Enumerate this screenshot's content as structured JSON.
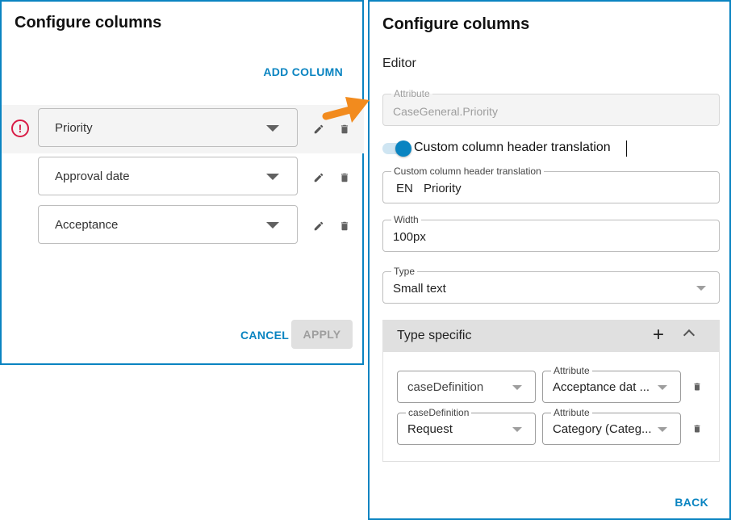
{
  "left_panel": {
    "title": "Configure columns",
    "add_column_label": "ADD COLUMN",
    "columns": [
      {
        "value": "Priority",
        "error": true
      },
      {
        "value": "Approval date",
        "error": false
      },
      {
        "value": "Acceptance",
        "error": false
      }
    ],
    "cancel_label": "CANCEL",
    "apply_label": "APPLY",
    "error_icon": "error-circle-icon",
    "edit_icon": "pencil-icon",
    "delete_icon": "trash-icon"
  },
  "right_panel": {
    "title": "Configure columns",
    "section_label": "Editor",
    "attribute": {
      "label": "Attribute",
      "value": "CaseGeneral.Priority"
    },
    "toggle": {
      "label": "Custom column header translation",
      "checked": true
    },
    "translation": {
      "label": "Custom column header translation",
      "language": "EN",
      "value": "Priority"
    },
    "width": {
      "label": "Width",
      "value": "100px"
    },
    "type": {
      "label": "Type",
      "value": "Small text"
    },
    "type_specific": {
      "title": "Type specific",
      "add_icon": "plus-icon",
      "collapse_icon": "chevron-up-icon",
      "rows": [
        {
          "case_label": "",
          "case_value": "caseDefinition",
          "attr_label": "Attribute",
          "attr_value": "Acceptance dat ..."
        },
        {
          "case_label": "caseDefinition",
          "case_value": "Request",
          "attr_label": "Attribute",
          "attr_value": "Category (Categ..."
        }
      ]
    },
    "back_label": "BACK"
  },
  "colors": {
    "accent": "#0a84c1",
    "error": "#d81b45",
    "arrow": "#f28b1e"
  }
}
